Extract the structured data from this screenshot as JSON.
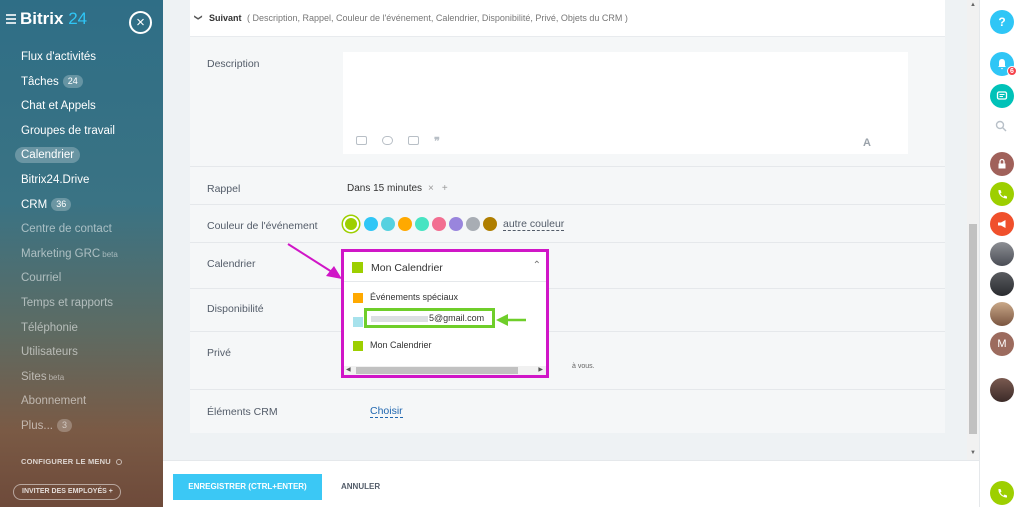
{
  "sidebar": {
    "logo_main": "Bitrix",
    "logo_num": "24",
    "close_glyph": "×",
    "items": [
      {
        "label": "Flux d'activités"
      },
      {
        "label": "Tâches",
        "count": "24"
      },
      {
        "label": "Chat et Appels"
      },
      {
        "label": "Groupes de travail"
      },
      {
        "label": "Calendrier"
      },
      {
        "label": "Bitrix24.Drive"
      },
      {
        "label": "CRM",
        "count": "36"
      },
      {
        "label": "Centre de contact"
      },
      {
        "label": "Marketing GRC",
        "tag": "beta"
      },
      {
        "label": "Courriel"
      },
      {
        "label": "Temps et rapports"
      },
      {
        "label": "Téléphonie"
      },
      {
        "label": "Utilisateurs"
      },
      {
        "label": "Sites",
        "tag": "beta"
      },
      {
        "label": "Abonnement"
      },
      {
        "label": "Plus...",
        "count": "3"
      }
    ],
    "configure_menu": "CONFIGURER LE MENU",
    "invite": "INVITER DES EMPLOYÉS",
    "invite_plus": "+"
  },
  "form": {
    "more_chevron": "❯",
    "more_label": "Suivant",
    "more_list": "( Description,  Rappel,  Couleur de l'événement,  Calendrier,  Disponibilité,  Privé,  Objets du CRM )",
    "description_label": "Description",
    "editor_a": "A",
    "editor_quote": "❞",
    "reminder_label": "Rappel",
    "reminder_value": "Dans 15 minutes",
    "reminder_remove": "×",
    "reminder_add": "+",
    "color_label": "Couleur de l'événement",
    "colors": [
      "#9dcf00",
      "#2fc6f6",
      "#56d1e0",
      "#ffa900",
      "#47e4c2",
      "#f26e91",
      "#9985dd",
      "#a8adb4",
      "#af7e00"
    ],
    "other_color": "autre couleur",
    "calendar_label": "Calendrier",
    "availability_label": "Disponibilité",
    "private_label": "Privé",
    "private_note": "à vous.",
    "crm_label": "Éléments CRM",
    "crm_link": "Choisir"
  },
  "dropdown": {
    "selected": "Mon Calendrier",
    "selected_color": "#9dcf00",
    "caret": "⌃",
    "options": [
      {
        "label": "Événements spéciaux",
        "color": "#ffa900"
      },
      {
        "label": "5@gmail.com",
        "color": "#a7e2ec"
      },
      {
        "label": "Mon Calendrier",
        "color": "#9dcf00"
      }
    ],
    "scroll_left": "◀",
    "scroll_right": "▶"
  },
  "buttons": {
    "save": "ENREGISTRER (CTRL+ENTER)",
    "cancel": "ANNULER"
  },
  "rightbar": {
    "help": "?",
    "notif_badge": "6",
    "avatar_initial": "M"
  },
  "scroll": {
    "up": "▲",
    "down": "▼"
  }
}
